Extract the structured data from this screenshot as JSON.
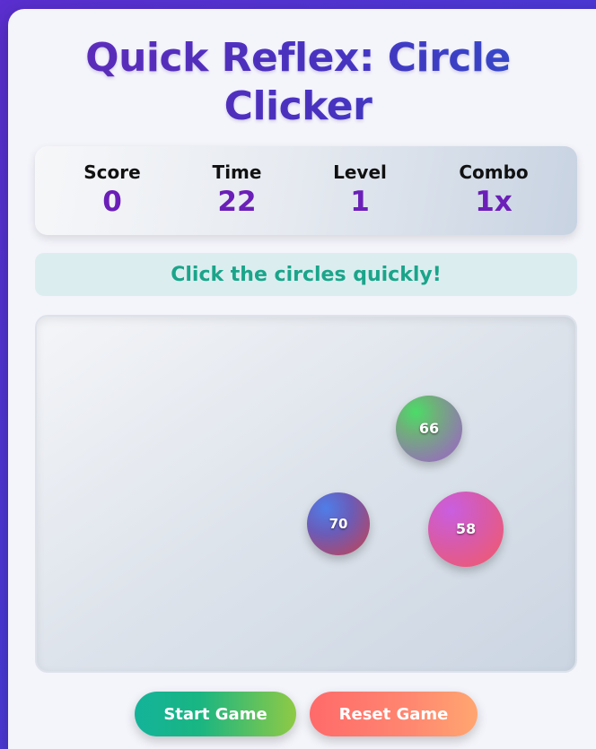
{
  "title": {
    "line1": "Quick Reflex: Circle",
    "line2": "Clicker"
  },
  "stats": {
    "score": {
      "label": "Score",
      "value": "0"
    },
    "time": {
      "label": "Time",
      "value": "22"
    },
    "level": {
      "label": "Level",
      "value": "1"
    },
    "combo": {
      "label": "Combo",
      "value": "1x"
    }
  },
  "message": "Click the circles quickly!",
  "circles": [
    {
      "points": "66"
    },
    {
      "points": "70"
    },
    {
      "points": "58"
    }
  ],
  "controls": {
    "start_label": "Start Game",
    "reset_label": "Reset Game"
  },
  "colors": {
    "accent": "#6b1fb8",
    "message": "#1aa58a",
    "background": "#5b2fd0"
  }
}
